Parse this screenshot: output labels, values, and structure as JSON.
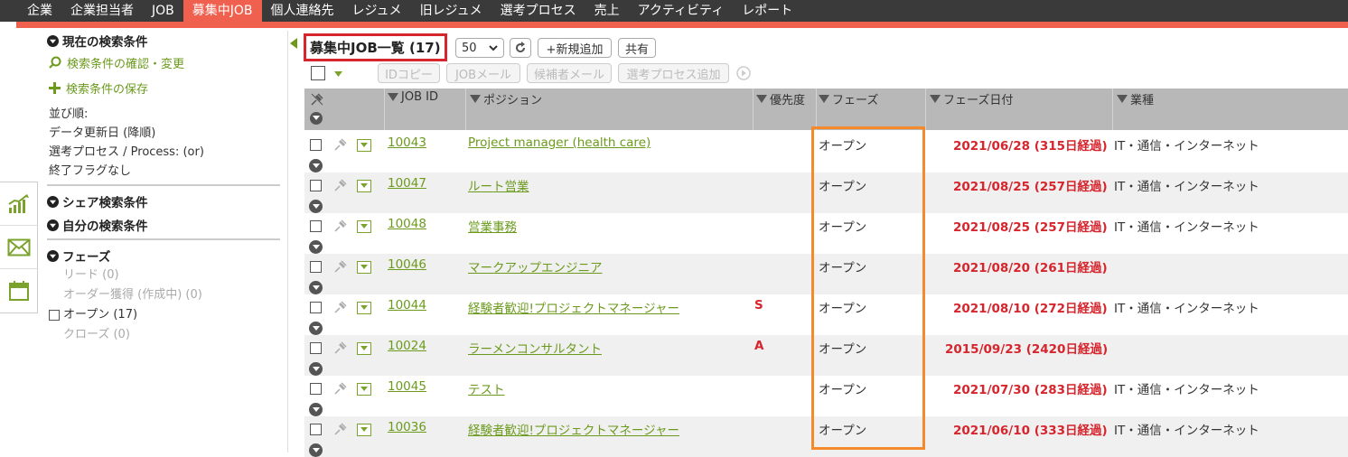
{
  "nav": {
    "items": [
      {
        "label": "企業",
        "active": false
      },
      {
        "label": "企業担当者",
        "active": false
      },
      {
        "label": "JOB",
        "active": false
      },
      {
        "label": "募集中JOB",
        "active": true
      },
      {
        "label": "個人連絡先",
        "active": false
      },
      {
        "label": "レジュメ",
        "active": false
      },
      {
        "label": "旧レジュメ",
        "active": false
      },
      {
        "label": "選考プロセス",
        "active": false
      },
      {
        "label": "売上",
        "active": false
      },
      {
        "label": "アクティビティ",
        "active": false
      },
      {
        "label": "レポート",
        "active": false
      }
    ]
  },
  "sidebar": {
    "current_conditions_label": "現在の検索条件",
    "confirm_change_label": "検索条件の確認・変更",
    "save_label": "検索条件の保存",
    "sort_lines": [
      "並び順:",
      "データ更新日 (降順)",
      "選考プロセス / Process: (or)",
      "終了フラグなし"
    ],
    "shared_conditions_label": "シェア検索条件",
    "my_conditions_label": "自分の検索条件",
    "phase_label": "フェーズ",
    "phase_lead": "リード (0)",
    "phase_order": "オーダー獲得 (作成中) (0)",
    "phase_open": "オープン (17)",
    "phase_close": "クローズ (0)"
  },
  "main": {
    "title": "募集中JOB一覧 (17)",
    "per_page": "50",
    "new_button": "+新規追加",
    "share_button": "共有",
    "bulk_buttons": [
      "IDコピー",
      "JOBメール",
      "候補者メール",
      "選考プロセス追加"
    ]
  },
  "table": {
    "headers": {
      "job_id": "JOB ID",
      "position": "ポジション",
      "priority": "優先度",
      "phase": "フェーズ",
      "phase_date": "フェーズ日付",
      "industry": "業種"
    },
    "rows": [
      {
        "id": "10043",
        "position": "Project manager (health care)",
        "priority": "",
        "phase": "オープン",
        "date": "2021/06/28 (315日経過)",
        "industry": "IT・通信・インターネット"
      },
      {
        "id": "10047",
        "position": "ルート営業",
        "priority": "",
        "phase": "オープン",
        "date": "2021/08/25 (257日経過)",
        "industry": "IT・通信・インターネット"
      },
      {
        "id": "10048",
        "position": "営業事務",
        "priority": "",
        "phase": "オープン",
        "date": "2021/08/25 (257日経過)",
        "industry": "IT・通信・インターネット"
      },
      {
        "id": "10046",
        "position": "マークアップエンジニア",
        "priority": "",
        "phase": "オープン",
        "date": "2021/08/20 (261日経過)",
        "industry": ""
      },
      {
        "id": "10044",
        "position": "経験者歓迎!プロジェクトマネージャー",
        "priority": "S",
        "phase": "オープン",
        "date": "2021/08/10 (272日経過)",
        "industry": "IT・通信・インターネット"
      },
      {
        "id": "10024",
        "position": "ラーメンコンサルタント",
        "priority": "A",
        "phase": "オープン",
        "date": "2015/09/23 (2420日経過)",
        "industry": ""
      },
      {
        "id": "10045",
        "position": "テスト",
        "priority": "",
        "phase": "オープン",
        "date": "2021/07/30 (283日経過)",
        "industry": "IT・通信・インターネット"
      },
      {
        "id": "10036",
        "position": "経験者歓迎!プロジェクトマネージャー",
        "priority": "",
        "phase": "オープン",
        "date": "2021/06/10 (333日経過)",
        "industry": "IT・通信・インターネット"
      }
    ]
  },
  "colors": {
    "accent_red": "#f0604f",
    "link_green": "#6b9a1d",
    "date_red": "#d6252d",
    "highlight_orange": "#f48a2c"
  }
}
